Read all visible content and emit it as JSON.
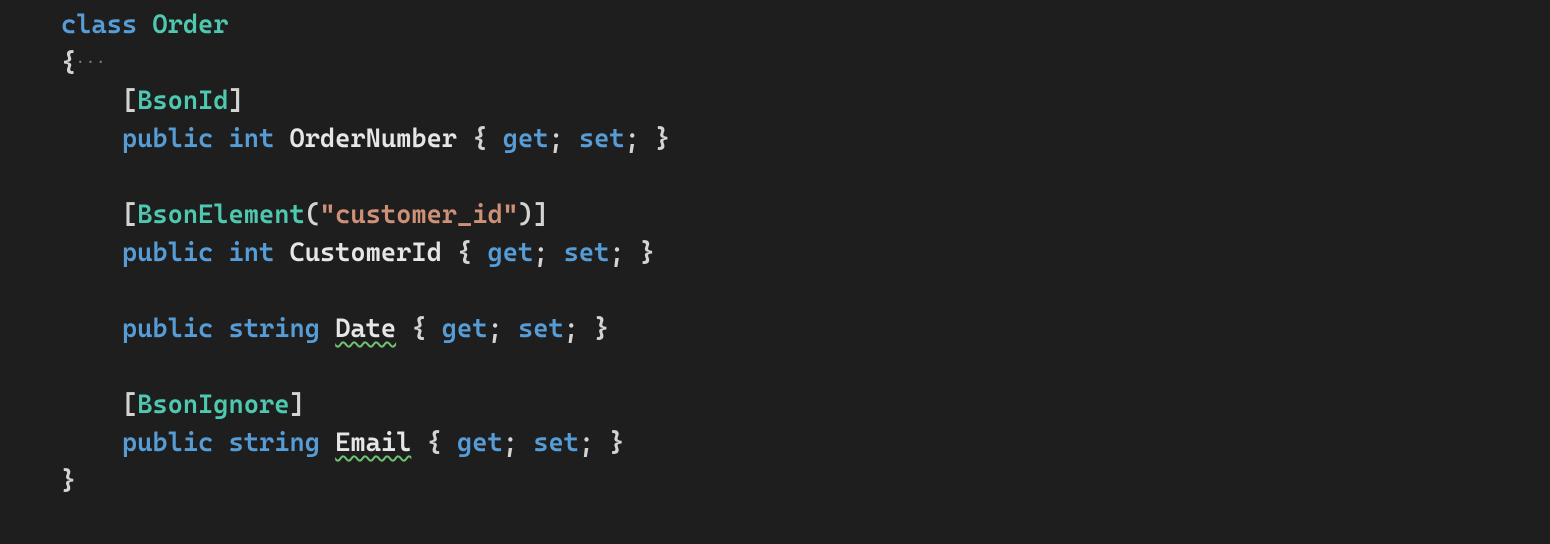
{
  "code": {
    "indent": "    ",
    "indent2": "        ",
    "kw_class": "class",
    "cls_name": "Order",
    "brace_open": "{",
    "brace_close": "}",
    "open_bracket": "[",
    "close_bracket": "]",
    "paren_open": "(",
    "paren_close": ")",
    "kw_public": "public",
    "kw_int": "int",
    "kw_string": "string",
    "kw_get": "get",
    "kw_set": "set",
    "semi": ";",
    "space": " ",
    "attr_BsonId": "BsonId",
    "attr_BsonElement": "BsonElement",
    "attr_BsonElement_arg": "\"customer_id\"",
    "attr_BsonIgnore": "BsonIgnore",
    "prop_OrderNumber": "OrderNumber",
    "prop_CustomerId": "CustomerId",
    "prop_Date": "Date",
    "prop_Email": "Email",
    "hint_dots": "···"
  }
}
